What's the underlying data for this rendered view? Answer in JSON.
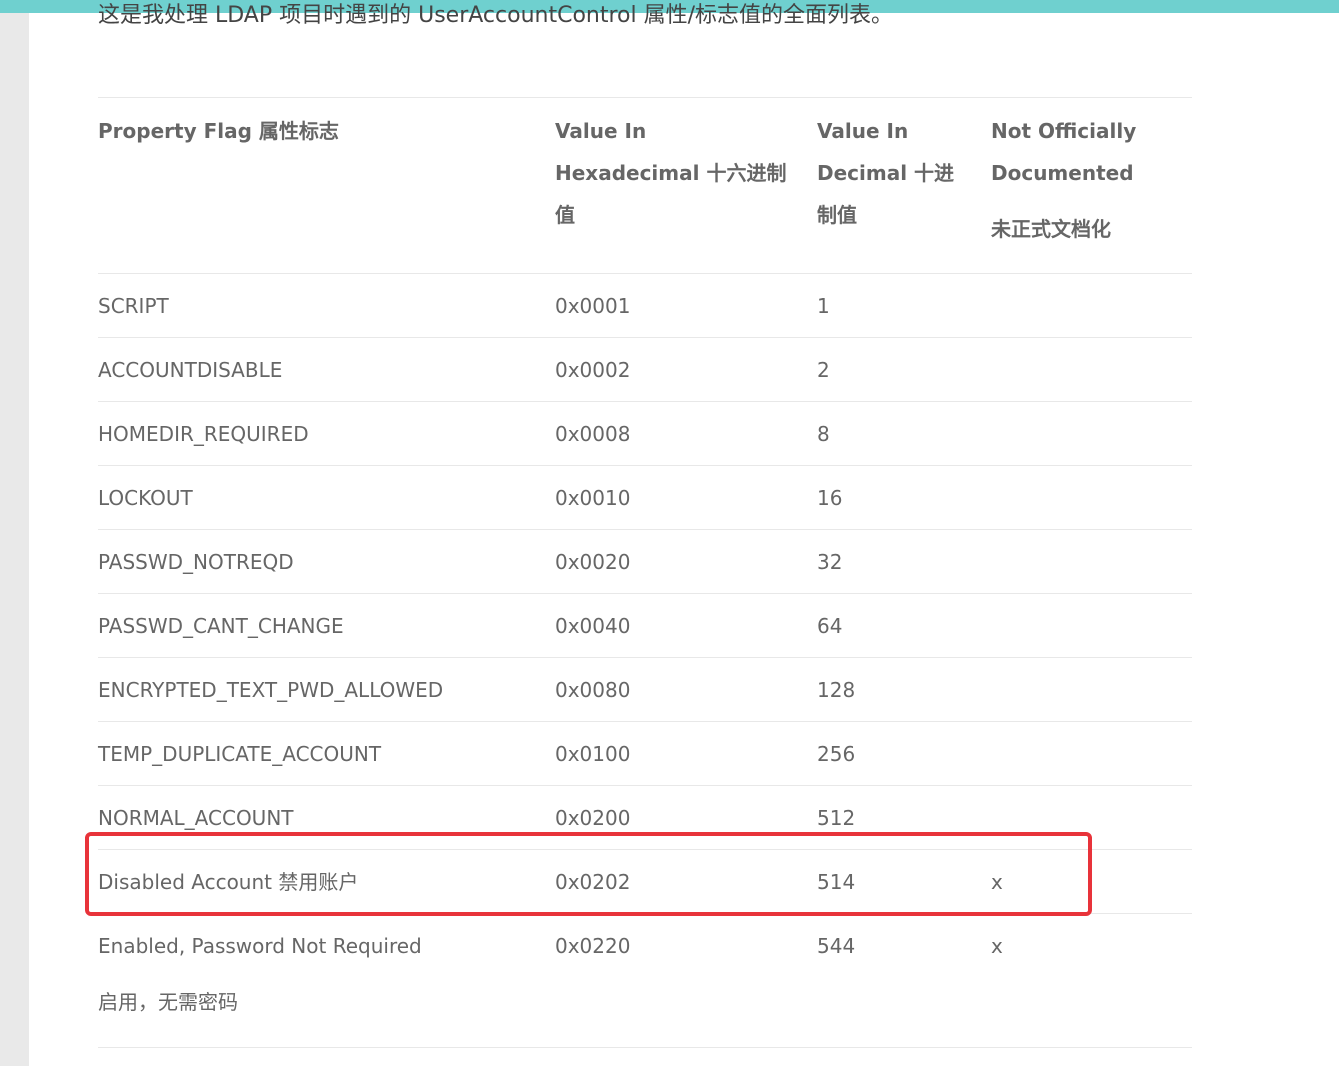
{
  "intro_text": "这是我处理 LDAP 项目时遇到的 UserAccountControl 属性/标志值的全面列表。",
  "colors": {
    "top_bar": "#6fd0cf",
    "highlight": "#e8333a"
  },
  "table": {
    "headers": {
      "flag": "Property Flag  属性标志",
      "hex_line1": "Value In",
      "hex_line2": "Hexadecimal  十六进制",
      "hex_line3": "值",
      "dec_line1": "Value In",
      "dec_line2": "Decimal  十进",
      "dec_line3": "制值",
      "doc_line1": "Not Officially",
      "doc_line2": "Documented",
      "doc_line3": "未正式文档化"
    },
    "rows": [
      {
        "flag": "SCRIPT",
        "hex": "0x0001",
        "dec": "1",
        "doc": ""
      },
      {
        "flag": "ACCOUNTDISABLE",
        "hex": "0x0002",
        "dec": "2",
        "doc": ""
      },
      {
        "flag": "HOMEDIR_REQUIRED",
        "hex": "0x0008",
        "dec": "8",
        "doc": ""
      },
      {
        "flag": "LOCKOUT",
        "hex": "0x0010",
        "dec": "16",
        "doc": ""
      },
      {
        "flag": "PASSWD_NOTREQD",
        "hex": "0x0020",
        "dec": "32",
        "doc": ""
      },
      {
        "flag": "PASSWD_CANT_CHANGE",
        "hex": "0x0040",
        "dec": "64",
        "doc": ""
      },
      {
        "flag": "ENCRYPTED_TEXT_PWD_ALLOWED",
        "hex": "0x0080",
        "dec": "128",
        "doc": ""
      },
      {
        "flag": "TEMP_DUPLICATE_ACCOUNT",
        "hex": "0x0100",
        "dec": "256",
        "doc": ""
      },
      {
        "flag": "NORMAL_ACCOUNT",
        "hex": "0x0200",
        "dec": "512",
        "doc": ""
      },
      {
        "flag": "Disabled Account  禁用账户",
        "hex": "0x0202",
        "dec": "514",
        "doc": "x"
      },
      {
        "flag": "Enabled, Password Not Required",
        "flag_sub": "启用，无需密码",
        "hex": "0x0220",
        "dec": "544",
        "doc": "x"
      }
    ]
  }
}
